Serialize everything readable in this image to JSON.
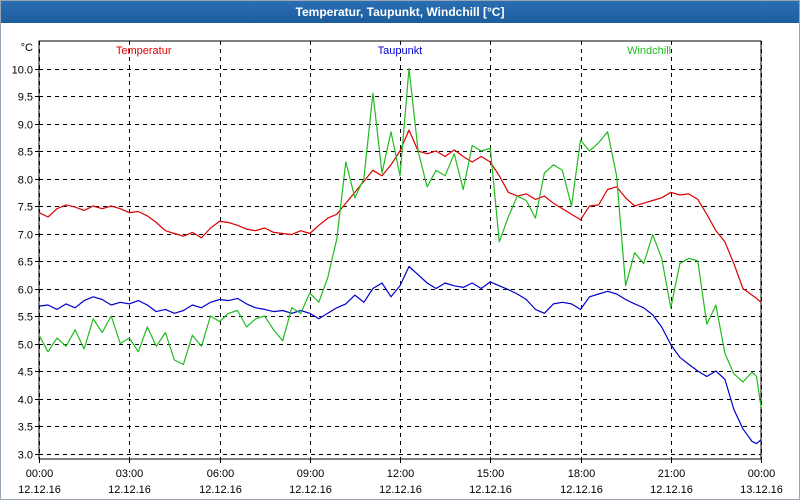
{
  "window": {
    "title": "Temperatur, Taupunkt, Windchill [°C]"
  },
  "chart_data": {
    "type": "line",
    "title": "Temperatur, Taupunkt, Windchill [°C]",
    "unit": "°C",
    "ylim": [
      2.9,
      10.5
    ],
    "y_ticks": [
      "3.0",
      "3.5",
      "4.0",
      "4.5",
      "5.0",
      "5.5",
      "6.0",
      "6.5",
      "7.0",
      "7.5",
      "8.0",
      "8.5",
      "9.0",
      "9.5",
      "10.0"
    ],
    "xlim": [
      0,
      24
    ],
    "x_ticks": [
      {
        "x": 0,
        "time": "00:00",
        "date": "12.12.16"
      },
      {
        "x": 3,
        "time": "03:00",
        "date": "12.12.16"
      },
      {
        "x": 6,
        "time": "06:00",
        "date": "12.12.16"
      },
      {
        "x": 9,
        "time": "09:00",
        "date": "12.12.16"
      },
      {
        "x": 12,
        "time": "12:00",
        "date": "12.12.16"
      },
      {
        "x": 15,
        "time": "15:00",
        "date": "12.12.16"
      },
      {
        "x": 18,
        "time": "18:00",
        "date": "12.12.16"
      },
      {
        "x": 21,
        "time": "21:00",
        "date": "12.12.16"
      },
      {
        "x": 24,
        "time": "00:00",
        "date": "13.12.16"
      }
    ],
    "grid": true,
    "series": [
      {
        "name": "Temperatur",
        "color": "#dd0000",
        "points": [
          [
            0.0,
            7.38
          ],
          [
            0.3,
            7.3
          ],
          [
            0.6,
            7.45
          ],
          [
            0.9,
            7.52
          ],
          [
            1.2,
            7.48
          ],
          [
            1.5,
            7.42
          ],
          [
            1.8,
            7.5
          ],
          [
            2.1,
            7.45
          ],
          [
            2.4,
            7.5
          ],
          [
            2.7,
            7.45
          ],
          [
            3.0,
            7.38
          ],
          [
            3.3,
            7.4
          ],
          [
            3.6,
            7.32
          ],
          [
            3.9,
            7.2
          ],
          [
            4.2,
            7.05
          ],
          [
            4.5,
            7.0
          ],
          [
            4.8,
            6.95
          ],
          [
            5.1,
            7.02
          ],
          [
            5.4,
            6.92
          ],
          [
            5.7,
            7.1
          ],
          [
            6.0,
            7.22
          ],
          [
            6.3,
            7.2
          ],
          [
            6.6,
            7.15
          ],
          [
            6.9,
            7.08
          ],
          [
            7.2,
            7.05
          ],
          [
            7.5,
            7.1
          ],
          [
            7.8,
            7.02
          ],
          [
            8.1,
            7.0
          ],
          [
            8.4,
            6.98
          ],
          [
            8.7,
            7.05
          ],
          [
            9.0,
            7.0
          ],
          [
            9.3,
            7.15
          ],
          [
            9.6,
            7.28
          ],
          [
            9.9,
            7.35
          ],
          [
            10.2,
            7.55
          ],
          [
            10.5,
            7.75
          ],
          [
            10.8,
            7.95
          ],
          [
            11.1,
            8.15
          ],
          [
            11.4,
            8.05
          ],
          [
            11.7,
            8.25
          ],
          [
            12.0,
            8.5
          ],
          [
            12.3,
            8.88
          ],
          [
            12.6,
            8.5
          ],
          [
            12.9,
            8.45
          ],
          [
            13.2,
            8.5
          ],
          [
            13.5,
            8.4
          ],
          [
            13.8,
            8.52
          ],
          [
            14.1,
            8.4
          ],
          [
            14.4,
            8.3
          ],
          [
            14.7,
            8.4
          ],
          [
            15.0,
            8.3
          ],
          [
            15.3,
            8.05
          ],
          [
            15.6,
            7.75
          ],
          [
            15.9,
            7.68
          ],
          [
            16.2,
            7.72
          ],
          [
            16.5,
            7.62
          ],
          [
            16.8,
            7.68
          ],
          [
            17.1,
            7.55
          ],
          [
            17.4,
            7.45
          ],
          [
            17.7,
            7.35
          ],
          [
            18.0,
            7.25
          ],
          [
            18.3,
            7.5
          ],
          [
            18.6,
            7.52
          ],
          [
            18.9,
            7.8
          ],
          [
            19.2,
            7.85
          ],
          [
            19.5,
            7.65
          ],
          [
            19.8,
            7.5
          ],
          [
            20.1,
            7.55
          ],
          [
            20.4,
            7.6
          ],
          [
            20.7,
            7.65
          ],
          [
            21.0,
            7.75
          ],
          [
            21.3,
            7.7
          ],
          [
            21.6,
            7.72
          ],
          [
            21.9,
            7.62
          ],
          [
            22.2,
            7.35
          ],
          [
            22.5,
            7.05
          ],
          [
            22.8,
            6.85
          ],
          [
            23.1,
            6.45
          ],
          [
            23.4,
            6.0
          ],
          [
            23.7,
            5.88
          ],
          [
            23.85,
            5.82
          ],
          [
            24.0,
            5.75
          ]
        ]
      },
      {
        "name": "Taupunkt",
        "color": "#0000cc",
        "points": [
          [
            0.0,
            5.68
          ],
          [
            0.3,
            5.7
          ],
          [
            0.6,
            5.62
          ],
          [
            0.9,
            5.72
          ],
          [
            1.2,
            5.65
          ],
          [
            1.5,
            5.78
          ],
          [
            1.8,
            5.85
          ],
          [
            2.1,
            5.8
          ],
          [
            2.4,
            5.7
          ],
          [
            2.7,
            5.75
          ],
          [
            3.0,
            5.72
          ],
          [
            3.3,
            5.78
          ],
          [
            3.6,
            5.7
          ],
          [
            3.9,
            5.58
          ],
          [
            4.2,
            5.62
          ],
          [
            4.5,
            5.55
          ],
          [
            4.8,
            5.6
          ],
          [
            5.1,
            5.7
          ],
          [
            5.4,
            5.65
          ],
          [
            5.7,
            5.75
          ],
          [
            6.0,
            5.8
          ],
          [
            6.3,
            5.78
          ],
          [
            6.6,
            5.82
          ],
          [
            6.9,
            5.72
          ],
          [
            7.2,
            5.65
          ],
          [
            7.5,
            5.62
          ],
          [
            7.8,
            5.58
          ],
          [
            8.1,
            5.6
          ],
          [
            8.4,
            5.55
          ],
          [
            8.7,
            5.6
          ],
          [
            9.0,
            5.55
          ],
          [
            9.3,
            5.45
          ],
          [
            9.6,
            5.55
          ],
          [
            9.9,
            5.65
          ],
          [
            10.2,
            5.72
          ],
          [
            10.5,
            5.88
          ],
          [
            10.8,
            5.75
          ],
          [
            11.1,
            6.0
          ],
          [
            11.4,
            6.1
          ],
          [
            11.7,
            5.85
          ],
          [
            12.0,
            6.05
          ],
          [
            12.3,
            6.4
          ],
          [
            12.6,
            6.25
          ],
          [
            12.9,
            6.1
          ],
          [
            13.2,
            6.0
          ],
          [
            13.5,
            6.1
          ],
          [
            13.8,
            6.05
          ],
          [
            14.1,
            6.02
          ],
          [
            14.4,
            6.1
          ],
          [
            14.7,
            6.0
          ],
          [
            15.0,
            6.12
          ],
          [
            15.3,
            6.05
          ],
          [
            15.6,
            5.98
          ],
          [
            15.9,
            5.9
          ],
          [
            16.2,
            5.8
          ],
          [
            16.5,
            5.62
          ],
          [
            16.8,
            5.55
          ],
          [
            17.1,
            5.72
          ],
          [
            17.4,
            5.75
          ],
          [
            17.7,
            5.72
          ],
          [
            18.0,
            5.62
          ],
          [
            18.3,
            5.85
          ],
          [
            18.6,
            5.9
          ],
          [
            18.9,
            5.95
          ],
          [
            19.2,
            5.9
          ],
          [
            19.5,
            5.8
          ],
          [
            19.8,
            5.72
          ],
          [
            20.1,
            5.65
          ],
          [
            20.4,
            5.52
          ],
          [
            20.7,
            5.3
          ],
          [
            21.0,
            4.98
          ],
          [
            21.3,
            4.75
          ],
          [
            21.6,
            4.62
          ],
          [
            21.9,
            4.5
          ],
          [
            22.2,
            4.4
          ],
          [
            22.5,
            4.5
          ],
          [
            22.8,
            4.35
          ],
          [
            23.1,
            3.8
          ],
          [
            23.4,
            3.45
          ],
          [
            23.7,
            3.22
          ],
          [
            23.85,
            3.18
          ],
          [
            24.0,
            3.25
          ]
        ]
      },
      {
        "name": "Windchill",
        "color": "#22bb22",
        "points": [
          [
            0.0,
            5.15
          ],
          [
            0.3,
            4.85
          ],
          [
            0.6,
            5.1
          ],
          [
            0.9,
            4.95
          ],
          [
            1.2,
            5.25
          ],
          [
            1.5,
            4.9
          ],
          [
            1.8,
            5.45
          ],
          [
            2.1,
            5.2
          ],
          [
            2.4,
            5.5
          ],
          [
            2.7,
            5.0
          ],
          [
            3.0,
            5.1
          ],
          [
            3.3,
            4.85
          ],
          [
            3.6,
            5.3
          ],
          [
            3.9,
            4.95
          ],
          [
            4.2,
            5.2
          ],
          [
            4.5,
            4.7
          ],
          [
            4.8,
            4.62
          ],
          [
            5.1,
            5.15
          ],
          [
            5.4,
            4.95
          ],
          [
            5.7,
            5.5
          ],
          [
            6.0,
            5.4
          ],
          [
            6.3,
            5.55
          ],
          [
            6.6,
            5.6
          ],
          [
            6.9,
            5.3
          ],
          [
            7.2,
            5.45
          ],
          [
            7.5,
            5.5
          ],
          [
            7.8,
            5.25
          ],
          [
            8.1,
            5.05
          ],
          [
            8.4,
            5.65
          ],
          [
            8.7,
            5.55
          ],
          [
            9.0,
            5.92
          ],
          [
            9.3,
            5.75
          ],
          [
            9.6,
            6.2
          ],
          [
            9.9,
            6.9
          ],
          [
            10.2,
            8.3
          ],
          [
            10.5,
            7.65
          ],
          [
            10.8,
            8.0
          ],
          [
            11.1,
            9.55
          ],
          [
            11.4,
            8.1
          ],
          [
            11.7,
            8.85
          ],
          [
            12.0,
            8.05
          ],
          [
            12.3,
            10.0
          ],
          [
            12.6,
            8.5
          ],
          [
            12.9,
            7.85
          ],
          [
            13.2,
            8.15
          ],
          [
            13.5,
            8.05
          ],
          [
            13.8,
            8.45
          ],
          [
            14.1,
            7.8
          ],
          [
            14.4,
            8.6
          ],
          [
            14.7,
            8.5
          ],
          [
            15.0,
            8.55
          ],
          [
            15.3,
            6.85
          ],
          [
            15.6,
            7.3
          ],
          [
            15.9,
            7.68
          ],
          [
            16.2,
            7.6
          ],
          [
            16.5,
            7.28
          ],
          [
            16.8,
            8.1
          ],
          [
            17.1,
            8.25
          ],
          [
            17.4,
            8.15
          ],
          [
            17.7,
            7.5
          ],
          [
            18.0,
            8.7
          ],
          [
            18.3,
            8.5
          ],
          [
            18.6,
            8.65
          ],
          [
            18.9,
            8.85
          ],
          [
            19.2,
            8.05
          ],
          [
            19.5,
            6.05
          ],
          [
            19.8,
            6.65
          ],
          [
            20.1,
            6.45
          ],
          [
            20.4,
            6.98
          ],
          [
            20.7,
            6.55
          ],
          [
            21.0,
            5.65
          ],
          [
            21.3,
            6.45
          ],
          [
            21.6,
            6.55
          ],
          [
            21.9,
            6.5
          ],
          [
            22.2,
            5.35
          ],
          [
            22.5,
            5.7
          ],
          [
            22.8,
            4.82
          ],
          [
            23.1,
            4.45
          ],
          [
            23.4,
            4.3
          ],
          [
            23.7,
            4.48
          ],
          [
            23.85,
            4.4
          ],
          [
            24.0,
            3.85
          ]
        ]
      }
    ]
  }
}
